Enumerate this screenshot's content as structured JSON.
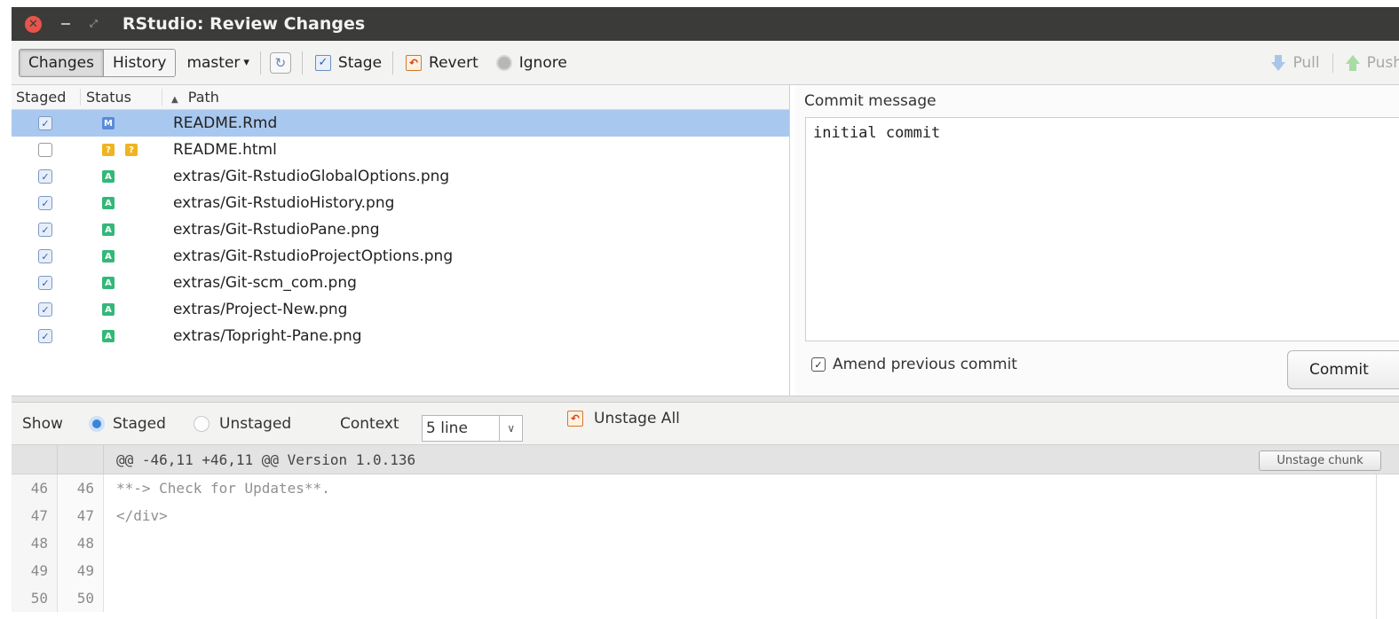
{
  "window": {
    "title": "RStudio: Review Changes",
    "close_glyph": "✕",
    "max_glyph": "⤢"
  },
  "toolbar": {
    "tabs": [
      {
        "label": "Changes",
        "active": true
      },
      {
        "label": "History",
        "active": false
      }
    ],
    "branch": "master",
    "branch_arrow": "▾",
    "refresh_glyph": "↻",
    "stage_label": "Stage",
    "revert_label": "Revert",
    "ignore_label": "Ignore",
    "pull_label": "Pull",
    "push_label": "Push",
    "icons": {
      "refresh": "refresh-icon",
      "stage": "check-icon",
      "revert": "revert-icon",
      "ignore": "ignore-icon",
      "pull": "pull-arrow-icon",
      "push": "push-arrow-icon"
    }
  },
  "files": {
    "headers": {
      "staged": "Staged",
      "status": "Status",
      "path": "Path",
      "sort_glyph": "▲"
    },
    "rows": [
      {
        "staged": true,
        "status": [
          "M"
        ],
        "path": "README.Rmd",
        "selected": true
      },
      {
        "staged": false,
        "status": [
          "?",
          "?"
        ],
        "path": "README.html",
        "selected": false
      },
      {
        "staged": true,
        "status": [
          "A"
        ],
        "path": "extras/Git-RstudioGlobalOptions.png",
        "selected": false
      },
      {
        "staged": true,
        "status": [
          "A"
        ],
        "path": "extras/Git-RstudioHistory.png",
        "selected": false
      },
      {
        "staged": true,
        "status": [
          "A"
        ],
        "path": "extras/Git-RstudioPane.png",
        "selected": false
      },
      {
        "staged": true,
        "status": [
          "A"
        ],
        "path": "extras/Git-RstudioProjectOptions.png",
        "selected": false
      },
      {
        "staged": true,
        "status": [
          "A"
        ],
        "path": "extras/Git-scm_com.png",
        "selected": false
      },
      {
        "staged": true,
        "status": [
          "A"
        ],
        "path": "extras/Project-New.png",
        "selected": false
      },
      {
        "staged": true,
        "status": [
          "A"
        ],
        "path": "extras/Topright-Pane.png",
        "selected": false
      }
    ],
    "status_colors": {
      "M": "#5b8bd8",
      "?": "#f0b41e",
      "A": "#33b87a"
    }
  },
  "commit": {
    "label": "Commit message",
    "message": "initial commit",
    "amend_label": "Amend previous commit",
    "amend_checked": true,
    "button_label": "Commit"
  },
  "diff_toolbar": {
    "show_label": "Show",
    "staged_label": "Staged",
    "unstaged_label": "Unstaged",
    "selected": "Staged",
    "context_label": "Context",
    "context_value": "5 line",
    "unstage_all_label": "Unstage All"
  },
  "diff": {
    "hunk_header": "@@ -46,11 +46,11 @@ Version 1.0.136",
    "unstage_chunk_label": "Unstage chunk",
    "lines": [
      {
        "old": "46",
        "new": "46",
        "text": "**-> Check for Updates**."
      },
      {
        "old": "47",
        "new": "47",
        "text": "</div>"
      },
      {
        "old": "48",
        "new": "48",
        "text": ""
      },
      {
        "old": "49",
        "new": "49",
        "text": ""
      },
      {
        "old": "50",
        "new": "50",
        "text": ""
      }
    ]
  },
  "colors": {
    "titlebar": "#3b3b39",
    "selection": "#a9c8ef",
    "radio_accent": "#3c84d6"
  }
}
